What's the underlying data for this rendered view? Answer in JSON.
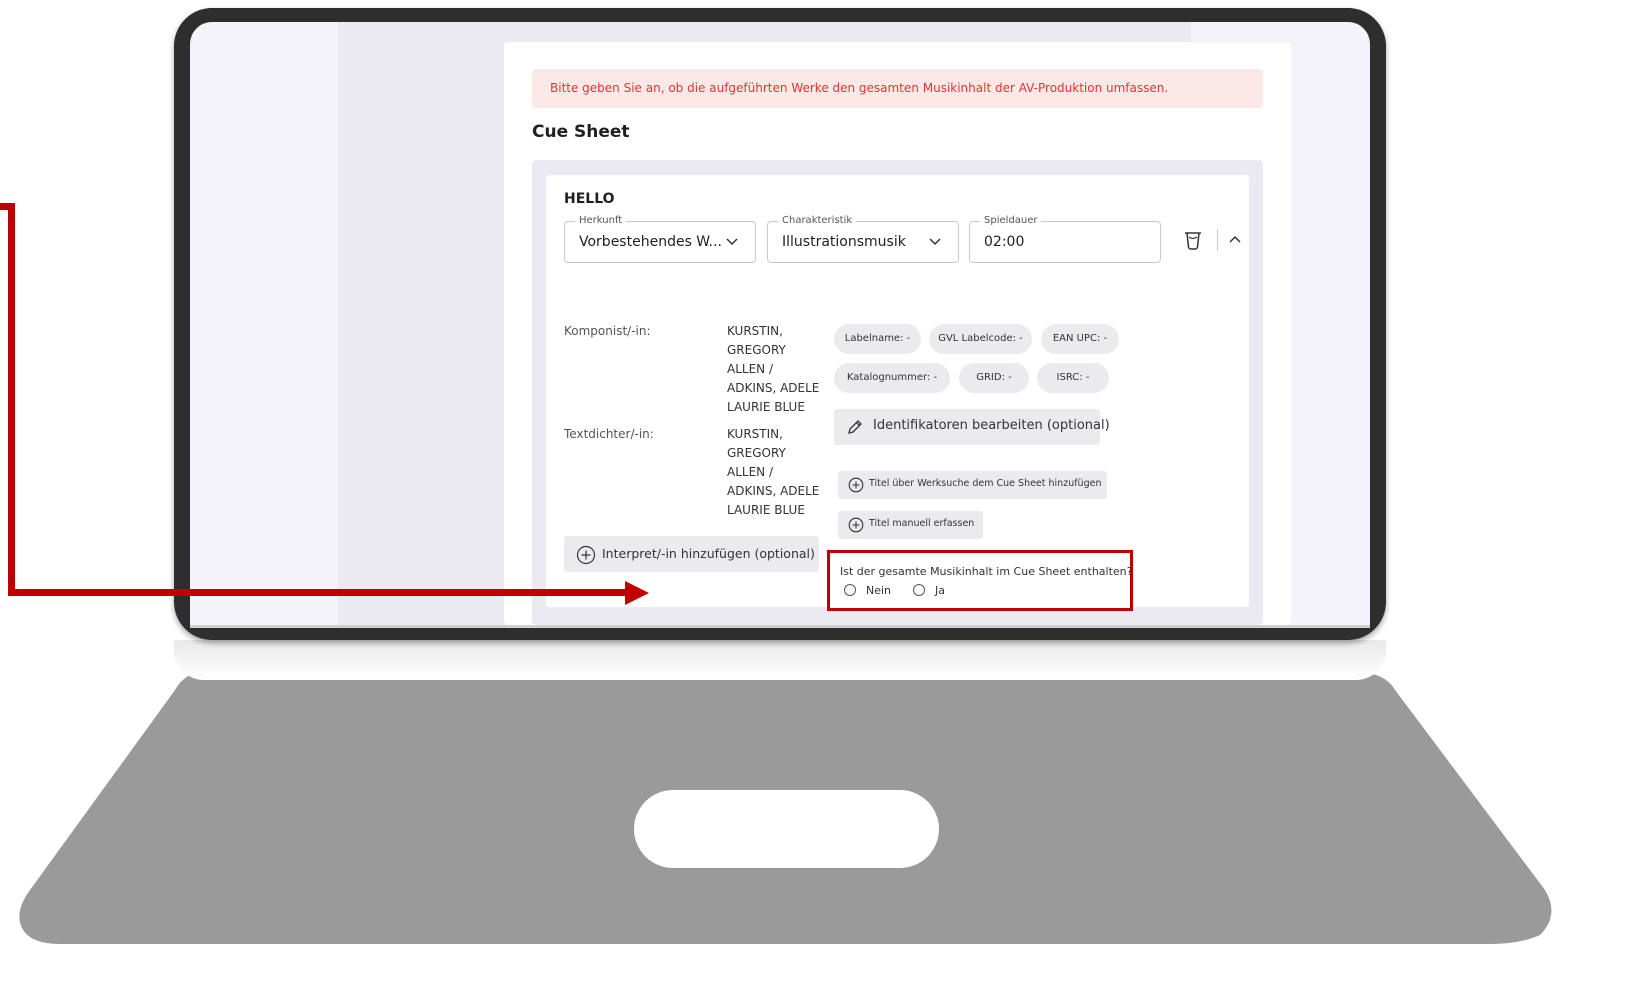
{
  "alert": {
    "text": "Bitte geben Sie an, ob die aufgeführten Werke den gesamten Musikinhalt der AV-Produktion umfassen."
  },
  "section_title": "Cue Sheet",
  "cue_item": {
    "title": "HELLO",
    "fields": {
      "herkunft": {
        "label": "Herkunft",
        "value": "Vorbestehendes W..."
      },
      "charakteristik": {
        "label": "Charakteristik",
        "value": "Illustrationsmusik"
      },
      "spieldauer": {
        "label": "Spieldauer",
        "value": "02:00"
      }
    },
    "komponist_label": "Komponist/-in:",
    "komponist_value": "KURSTIN, GREGORY ALLEN / ADKINS, ADELE LAURIE BLUE",
    "textdichter_label": "Textdichter/-in:",
    "textdichter_value": "KURSTIN, GREGORY ALLEN / ADKINS, ADELE LAURIE BLUE",
    "chips": {
      "labelname": "Labelname: -",
      "gvl_labelcode": "GVL Labelcode: -",
      "ean_upc": "EAN UPC: -",
      "katalognummer": "Katalognummer: -",
      "grid": "GRID: -",
      "isrc": "ISRC: -"
    },
    "edit_identifiers_label": "Identifikatoren bearbeiten (optional)",
    "add_title_search_label": "Titel über Werksuche dem Cue Sheet hinzufügen",
    "add_title_manual_label": "Titel manuell erfassen",
    "add_interpret_label": "Interpret/-in hinzufügen (optional)"
  },
  "question": {
    "text": "Ist der gesamte Musikinhalt im Cue Sheet enthalten?",
    "options": [
      "Nein",
      "Ja"
    ]
  },
  "colors": {
    "annotation_red": "#c00000",
    "alert_text": "#e5342f",
    "alert_bg": "#fde8e8"
  }
}
